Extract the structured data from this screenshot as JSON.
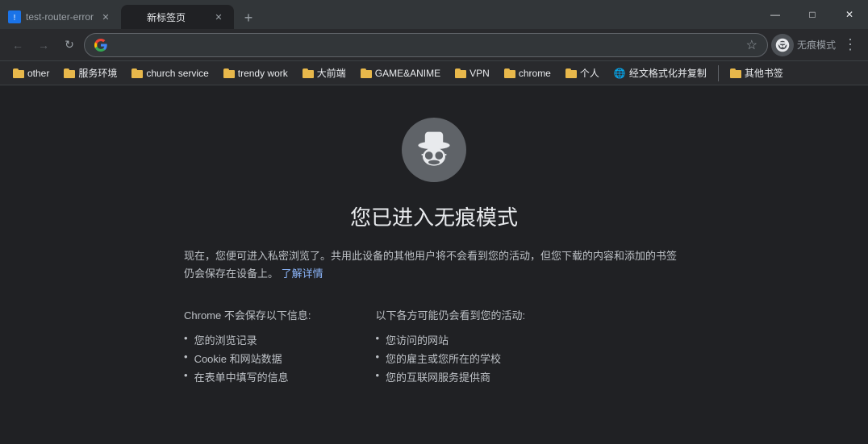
{
  "titleBar": {
    "tabs": [
      {
        "id": "tab1",
        "title": "test-router-error",
        "active": true,
        "favicon": "⚠"
      },
      {
        "id": "tab2",
        "title": "新标签页",
        "active": false,
        "favicon": ""
      }
    ],
    "addTabLabel": "+",
    "windowControls": {
      "minimize": "—",
      "maximize": "□",
      "close": "✕"
    }
  },
  "toolbar": {
    "backButton": "←",
    "forwardButton": "→",
    "reloadButton": "↻",
    "addressValue": "",
    "addressPlaceholder": "",
    "starButton": "☆",
    "profileLabel": "",
    "incognitoLabel": "无痕模式",
    "menuButton": "⋮"
  },
  "bookmarks": {
    "items": [
      {
        "id": "bm1",
        "label": "other"
      },
      {
        "id": "bm2",
        "label": "服务环境"
      },
      {
        "id": "bm3",
        "label": "church service"
      },
      {
        "id": "bm4",
        "label": "trendy work"
      },
      {
        "id": "bm5",
        "label": "大前端"
      },
      {
        "id": "bm6",
        "label": "GAME&ANIME"
      },
      {
        "id": "bm7",
        "label": "VPN"
      },
      {
        "id": "bm8",
        "label": "chrome"
      },
      {
        "id": "bm9",
        "label": "个人"
      },
      {
        "id": "bm10",
        "label": "经文格式化并复制"
      },
      {
        "id": "bm11",
        "label": "其他书签"
      }
    ]
  },
  "mainContent": {
    "title": "您已进入无痕模式",
    "description": "现在，您便可进入私密浏览了。共用此设备的其他用户将不会看到您的活动，但您下载的内容和添加的书签仍会保存在设备上。",
    "learnMoreText": "了解详情",
    "chromeWontSave": {
      "heading": "Chrome 不会保存以下信息:",
      "items": [
        "您的浏览记录",
        "Cookie 和网站数据",
        "在表单中填写的信息"
      ]
    },
    "othersMightSee": {
      "heading": "以下各方可能仍会看到您的活动:",
      "items": [
        "您访问的网站",
        "您的雇主或您所在的学校",
        "您的互联网服务提供商"
      ]
    }
  }
}
